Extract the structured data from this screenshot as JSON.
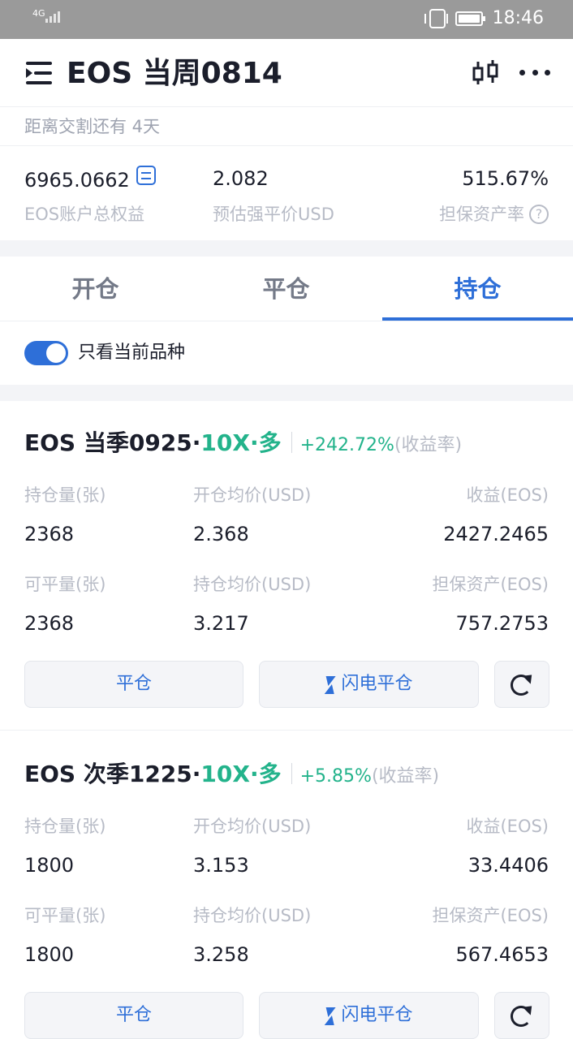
{
  "status_bar": {
    "network": "4G",
    "time": "18:46"
  },
  "header": {
    "title": "EOS 当周0814"
  },
  "delivery_text": "距离交割还有 4天",
  "account": {
    "equity_value": "6965.0662",
    "equity_label": "EOS账户总权益",
    "liq_price_value": "2.082",
    "liq_price_label": "预估强平价USD",
    "margin_ratio_value": "515.67%",
    "margin_ratio_label": "担保资产率"
  },
  "tabs": [
    {
      "label": "开仓"
    },
    {
      "label": "平仓"
    },
    {
      "label": "持仓",
      "active": true
    }
  ],
  "filter_toggle": {
    "label": "只看当前品种",
    "on": true
  },
  "positions": [
    {
      "name": "EOS 当季0925·",
      "leverage": "10X·多",
      "rate": "+242.72%",
      "rate_label": "(收益率)",
      "fields": {
        "hold_qty_label": "持仓量(张)",
        "hold_qty": "2368",
        "open_avg_label": "开仓均价(USD)",
        "open_avg": "2.368",
        "pnl_label": "收益(EOS)",
        "pnl": "2427.2465",
        "closable_label": "可平量(张)",
        "closable": "2368",
        "hold_avg_label": "持仓均价(USD)",
        "hold_avg": "3.217",
        "margin_label": "担保资产(EOS)",
        "margin": "757.2753"
      },
      "close_label": "平仓",
      "flash_close_label": "闪电平仓"
    },
    {
      "name": "EOS 次季1225·",
      "leverage": "10X·多",
      "rate": "+5.85%",
      "rate_label": "(收益率)",
      "fields": {
        "hold_qty_label": "持仓量(张)",
        "hold_qty": "1800",
        "open_avg_label": "开仓均价(USD)",
        "open_avg": "3.153",
        "pnl_label": "收益(EOS)",
        "pnl": "33.4406",
        "closable_label": "可平量(张)",
        "closable": "1800",
        "hold_avg_label": "持仓均价(USD)",
        "hold_avg": "3.258",
        "margin_label": "担保资产(EOS)",
        "margin": "567.4653"
      },
      "close_label": "平仓",
      "flash_close_label": "闪电平仓"
    }
  ],
  "colors": {
    "accent": "#2e6fd8",
    "profit": "#23b38b",
    "muted": "#b7bbc6"
  }
}
